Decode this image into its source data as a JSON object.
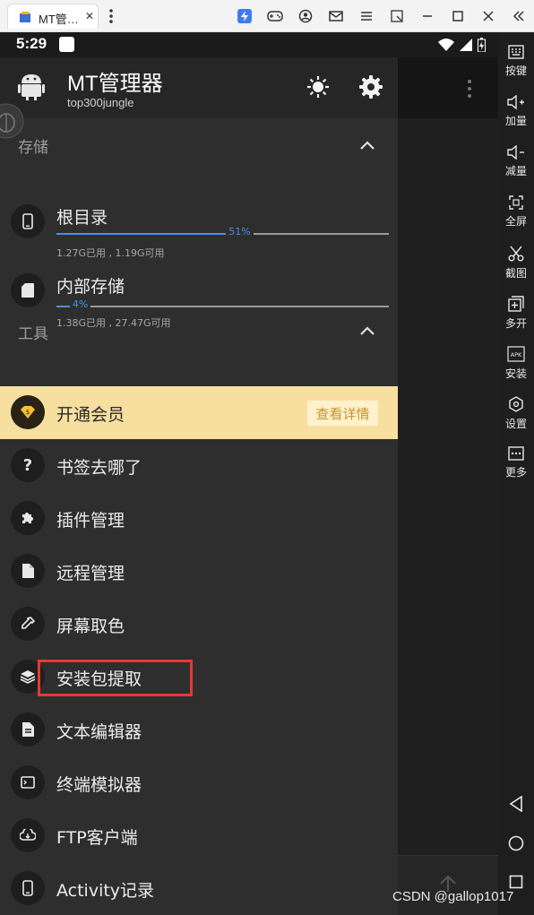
{
  "window": {
    "tab_title": "MT管…",
    "tab_close": "✕"
  },
  "status_bar": {
    "time": "5:29"
  },
  "drawer": {
    "app_title": "MT管理器",
    "app_subtitle": "top300jungle",
    "sections": {
      "storage": "存储",
      "tools": "工具"
    },
    "storage_items": [
      {
        "label": "根目录",
        "percent_text": "51%",
        "percent": 51,
        "detail": "1.27G已用 , 1.19G可用",
        "icon": "phone-icon"
      },
      {
        "label": "内部存储",
        "percent_text": "4%",
        "percent": 4,
        "detail": "1.38G已用 , 27.47G可用",
        "icon": "sd-card-icon"
      }
    ],
    "vip": {
      "label": "开通会员",
      "button": "查看详情",
      "icon": "vip-diamond-icon"
    },
    "tools": [
      {
        "label": "书签去哪了",
        "icon": "question-icon"
      },
      {
        "label": "插件管理",
        "icon": "puzzle-icon"
      },
      {
        "label": "远程管理",
        "icon": "file-icon"
      },
      {
        "label": "屏幕取色",
        "icon": "eyedropper-icon"
      },
      {
        "label": "安装包提取",
        "icon": "layers-icon"
      },
      {
        "label": "文本编辑器",
        "icon": "document-icon"
      },
      {
        "label": "终端模拟器",
        "icon": "terminal-icon"
      },
      {
        "label": "FTP客户端",
        "icon": "ftp-icon"
      },
      {
        "label": "Activity记录",
        "icon": "phone-icon"
      }
    ]
  },
  "emulator_sidebar": [
    {
      "label": "按键",
      "icon": "keyboard-icon"
    },
    {
      "label": "加量",
      "icon": "volume-up-icon"
    },
    {
      "label": "减量",
      "icon": "volume-down-icon"
    },
    {
      "label": "全屏",
      "icon": "fullscreen-icon"
    },
    {
      "label": "截图",
      "icon": "scissors-icon"
    },
    {
      "label": "多开",
      "icon": "multi-open-icon"
    },
    {
      "label": "安装",
      "icon": "apk-install-icon"
    },
    {
      "label": "设置",
      "icon": "settings-hex-icon"
    },
    {
      "label": "更多",
      "icon": "more-icon"
    }
  ],
  "watermark": "CSDN @gallop1017",
  "colors": {
    "accent_blue": "#4a90e2",
    "vip_background": "#f7dfa0",
    "highlight_red": "#e53935"
  }
}
